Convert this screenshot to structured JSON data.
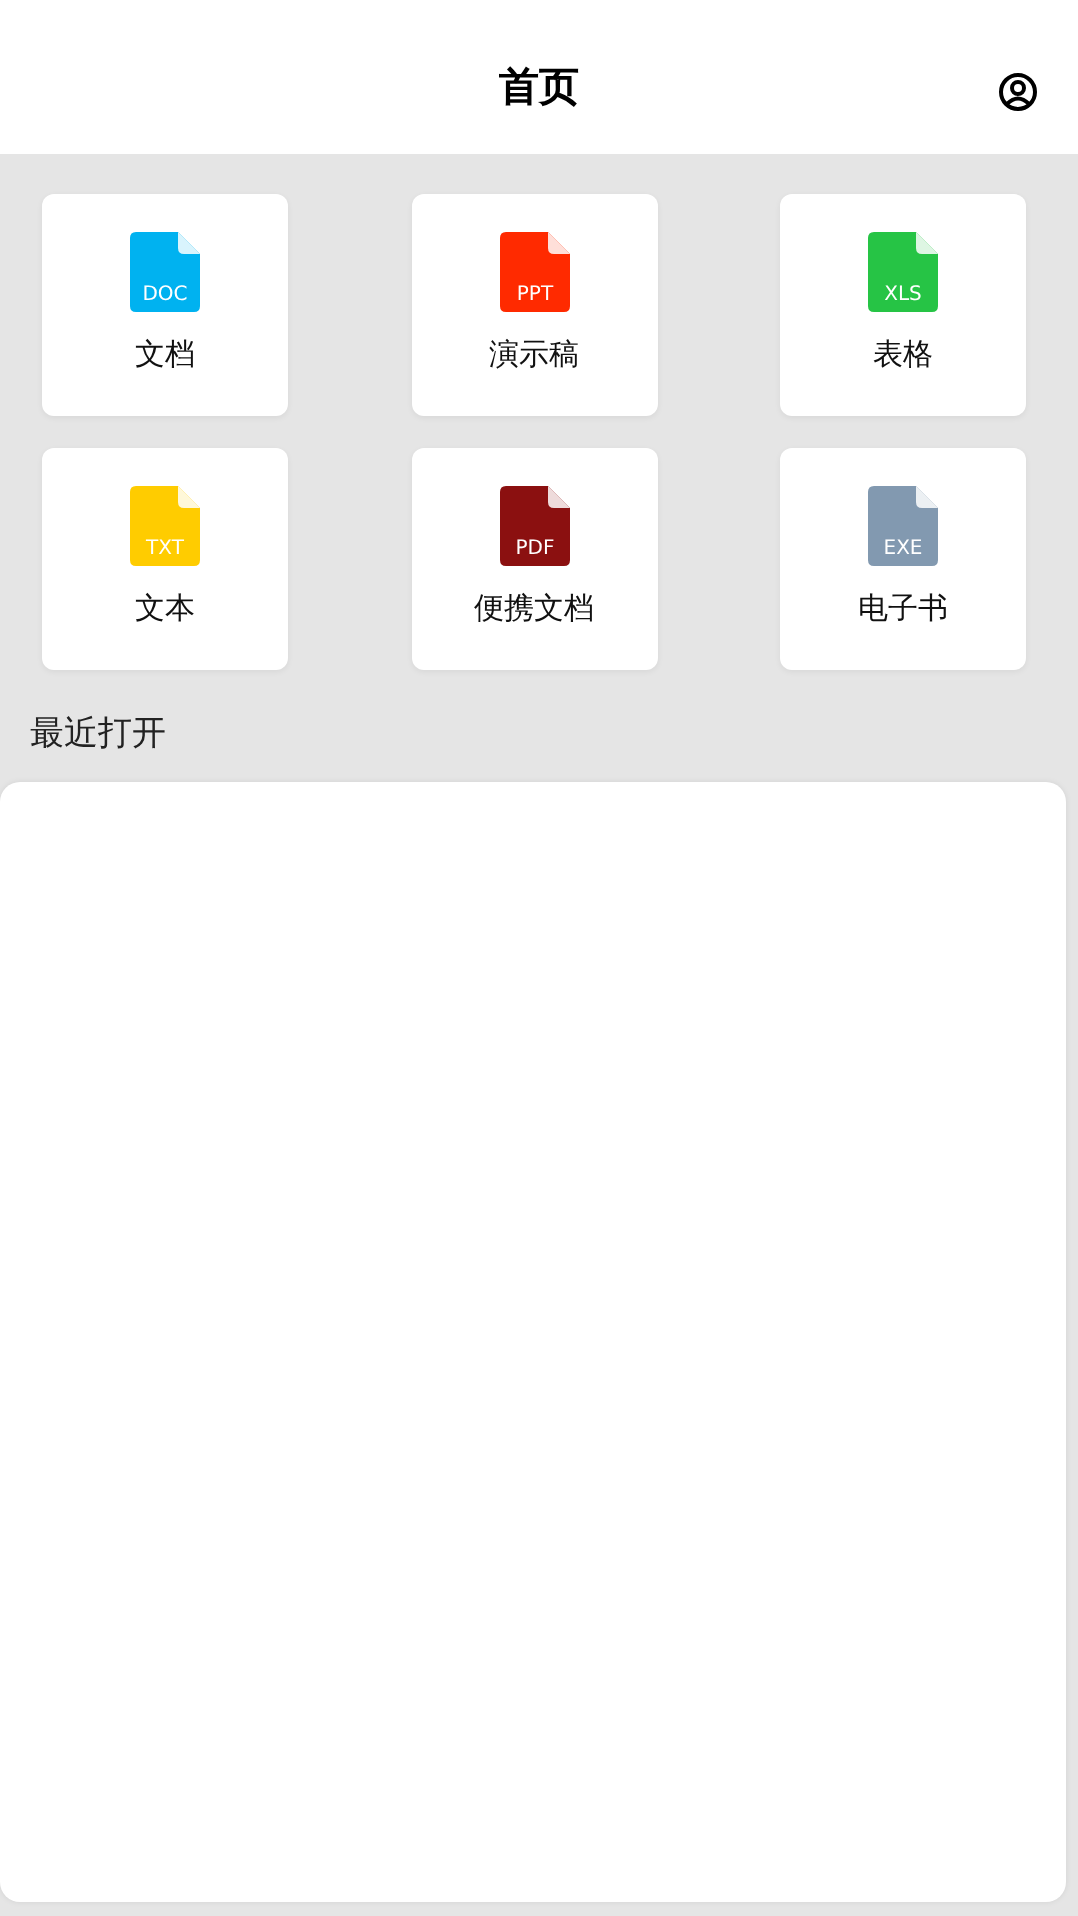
{
  "header": {
    "title": "首页"
  },
  "file_types": [
    {
      "ext": "DOC",
      "label": "文档",
      "color": "#00b2f0"
    },
    {
      "ext": "PPT",
      "label": "演示稿",
      "color": "#ff2a00"
    },
    {
      "ext": "XLS",
      "label": "表格",
      "color": "#26c445"
    },
    {
      "ext": "TXT",
      "label": "文本",
      "color": "#ffcc00"
    },
    {
      "ext": "PDF",
      "label": "便携文档",
      "color": "#8b1010"
    },
    {
      "ext": "EXE",
      "label": "电子书",
      "color": "#8299b0"
    }
  ],
  "recent": {
    "title": "最近打开"
  }
}
